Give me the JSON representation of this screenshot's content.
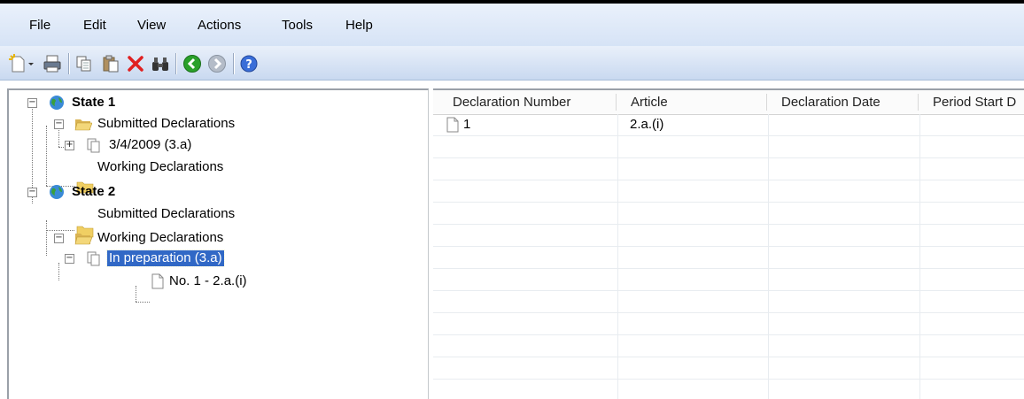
{
  "menu": {
    "items": [
      "File",
      "Edit",
      "View",
      "Actions",
      "Tools",
      "Help"
    ]
  },
  "toolbar": {
    "buttons": [
      "new-icon",
      "print-icon",
      "copy-icon",
      "paste-icon",
      "delete-icon",
      "find-icon",
      "back-icon",
      "forward-icon",
      "help-icon"
    ],
    "colors": {
      "delete": "#e02020",
      "back": "#2aa02a",
      "forward": "#9aa4b0",
      "help": "#3a6ed8"
    }
  },
  "tree": {
    "state1": {
      "label": "State 1",
      "submitted": "Submitted Declarations",
      "submitted_item": "3/4/2009 (3.a)",
      "working": "Working Declarations"
    },
    "state2": {
      "label": "State 2",
      "submitted": "Submitted Declarations",
      "working": "Working Declarations",
      "working_item": "In preparation (3.a)",
      "working_subitem": "No. 1 - 2.a.(i)"
    }
  },
  "grid": {
    "columns": [
      "Declaration Number",
      "Article",
      "Declaration Date",
      "Period Start D"
    ],
    "rows": [
      {
        "number": "1",
        "article": "2.a.(i)",
        "date": "",
        "period": ""
      }
    ]
  }
}
